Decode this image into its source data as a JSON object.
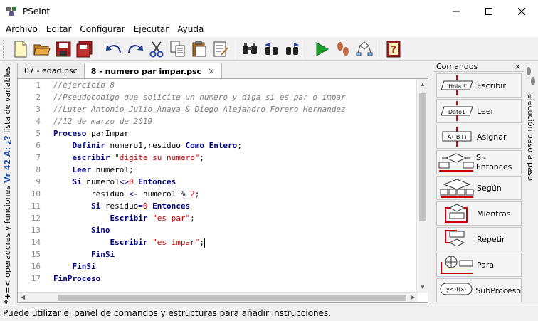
{
  "window": {
    "title": "PSeInt",
    "app_icon": "pseint-app-icon",
    "controls": [
      "minimize-icon",
      "maximize-icon",
      "close-icon"
    ]
  },
  "menu": [
    "Archivo",
    "Editar",
    "Configurar",
    "Ejecutar",
    "Ayuda"
  ],
  "toolbar": {
    "buttons": [
      "new-file-icon",
      "open-folder-icon",
      "save-icon",
      "save-as-icon",
      "undo-icon",
      "redo-icon",
      "cut-icon",
      "copy-icon",
      "paste-icon",
      "edit-icon",
      "search-icon",
      "search-prev-icon",
      "search-next-icon",
      "run-icon",
      "step-icon",
      "flowchart-icon",
      "help-icon"
    ]
  },
  "left_panel": {
    "variables_icon": "Vr 42 A: ¿?",
    "variables_label": "lista de variables",
    "operators_icon": "*+=<",
    "operators_label": "operadores y funciones"
  },
  "tabs": [
    {
      "label": "07 - edad.psc",
      "active": false
    },
    {
      "label": "8 - numero par impar.psc",
      "active": true,
      "close": "×"
    }
  ],
  "code": {
    "line_numbers": [
      "1",
      "2",
      "3",
      "4",
      "5",
      "6",
      "7",
      "8",
      "9",
      "10",
      "11",
      "12",
      "13",
      "14",
      "15",
      "16",
      "17"
    ],
    "l1": "//ejercicio 8",
    "l2": "//Pseudocodigo que solicite un numero y diga si es par o impar",
    "l3": "//Luter Antonio Julio Anaya & Diego Alejandro Forero Hernandez",
    "l4": "//12 de marzo de 2019",
    "l5_kw": "Proceso",
    "l5_id": " parImpar",
    "l6_kw1": "Definir",
    "l6_id": " numero1,residuo ",
    "l6_kw2": "Como Entero",
    "l6_end": ";",
    "l7_kw": "escribir",
    "l7_str": "\"digite su numero\"",
    "l7_end": ";",
    "l8_kw": "Leer",
    "l8_id": " numero1;",
    "l9_kw1": "Si",
    "l9_id": " numero1",
    "l9_op": "<>",
    "l9_num": "0",
    "l9_kw2": "Entonces",
    "l10_id": "residuo ",
    "l10_op": "<-",
    "l10_id2": " numero1 % ",
    "l10_num": "2",
    "l10_end": ";",
    "l11_kw1": "Si",
    "l11_id": " residuo",
    "l11_op": "=",
    "l11_num": "0",
    "l11_kw2": "Entonces",
    "l12_kw": "Escribir",
    "l12_str": "\"es par\"",
    "l12_end": ";",
    "l13_kw": "Sino",
    "l14_kw": "Escribir",
    "l14_str": "\"es impar\"",
    "l14_end": ";",
    "l15_kw": "FinSi",
    "l16_kw": "FinSi",
    "l17_kw": "FinProceso"
  },
  "commands": {
    "header": "Comandos",
    "close": "×",
    "items": [
      {
        "label": "Escribir",
        "icon": "escribir-icon",
        "icon_text": "'Hola !'"
      },
      {
        "label": "Leer",
        "icon": "leer-icon",
        "icon_text": "Dato1"
      },
      {
        "label": "Asignar",
        "icon": "asignar-icon",
        "icon_text": "A←B+i"
      },
      {
        "label": "Si-Entonces",
        "icon": "si-entonces-icon"
      },
      {
        "label": "Según",
        "icon": "segun-icon"
      },
      {
        "label": "Mientras",
        "icon": "mientras-icon"
      },
      {
        "label": "Repetir",
        "icon": "repetir-icon"
      },
      {
        "label": "Para",
        "icon": "para-icon"
      },
      {
        "label": "SubProceso",
        "icon": "subproceso-icon",
        "icon_text": "y<-f(x)"
      }
    ]
  },
  "right_panel": {
    "label": "ejecución paso a paso",
    "icon": "footsteps-icon"
  },
  "statusbar": {
    "message": "Puede utilizar el panel de comandos y estructuras para añadir instrucciones."
  },
  "colors": {
    "keyword": "#000080",
    "string": "#c00000",
    "comment": "#7b7b7b",
    "run_green": "#1a9e2c"
  }
}
